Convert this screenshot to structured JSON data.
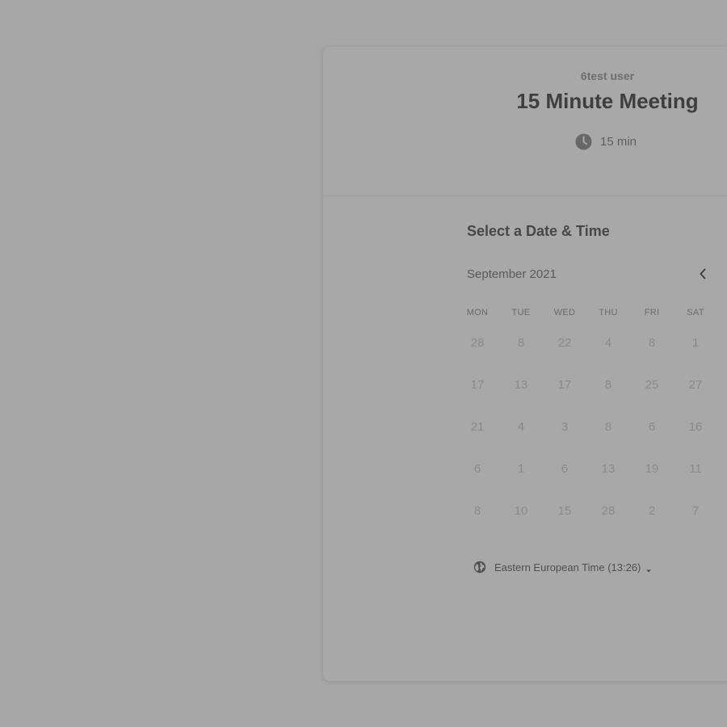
{
  "header": {
    "organizer": "6test user",
    "event_title": "15 Minute Meeting",
    "duration": "15 min",
    "duration_icon": "clock-icon"
  },
  "scheduler": {
    "section_title": "Select a Date & Time",
    "month_label": "September 2021",
    "prev_icon": "chevron-left-icon",
    "weekdays": [
      "MON",
      "TUE",
      "WED",
      "THU",
      "FRI",
      "SAT"
    ],
    "weeks": [
      [
        "28",
        "8",
        "22",
        "4",
        "8",
        "1"
      ],
      [
        "17",
        "13",
        "17",
        "8",
        "25",
        "27"
      ],
      [
        "21",
        "4",
        "3",
        "8",
        "6",
        "16"
      ],
      [
        "6",
        "1",
        "6",
        "13",
        "19",
        "11"
      ],
      [
        "8",
        "10",
        "15",
        "28",
        "2",
        "7"
      ]
    ],
    "timezone": {
      "label": "Eastern European Time (13:26)",
      "icon": "globe-icon",
      "caret_icon": "caret-down-icon"
    }
  },
  "colors": {
    "overlay_background": "#a6a6a6",
    "card_background": "#a8a8a8",
    "title_text": "#3e3e3e",
    "muted_day_text": "#8a8a8a"
  }
}
